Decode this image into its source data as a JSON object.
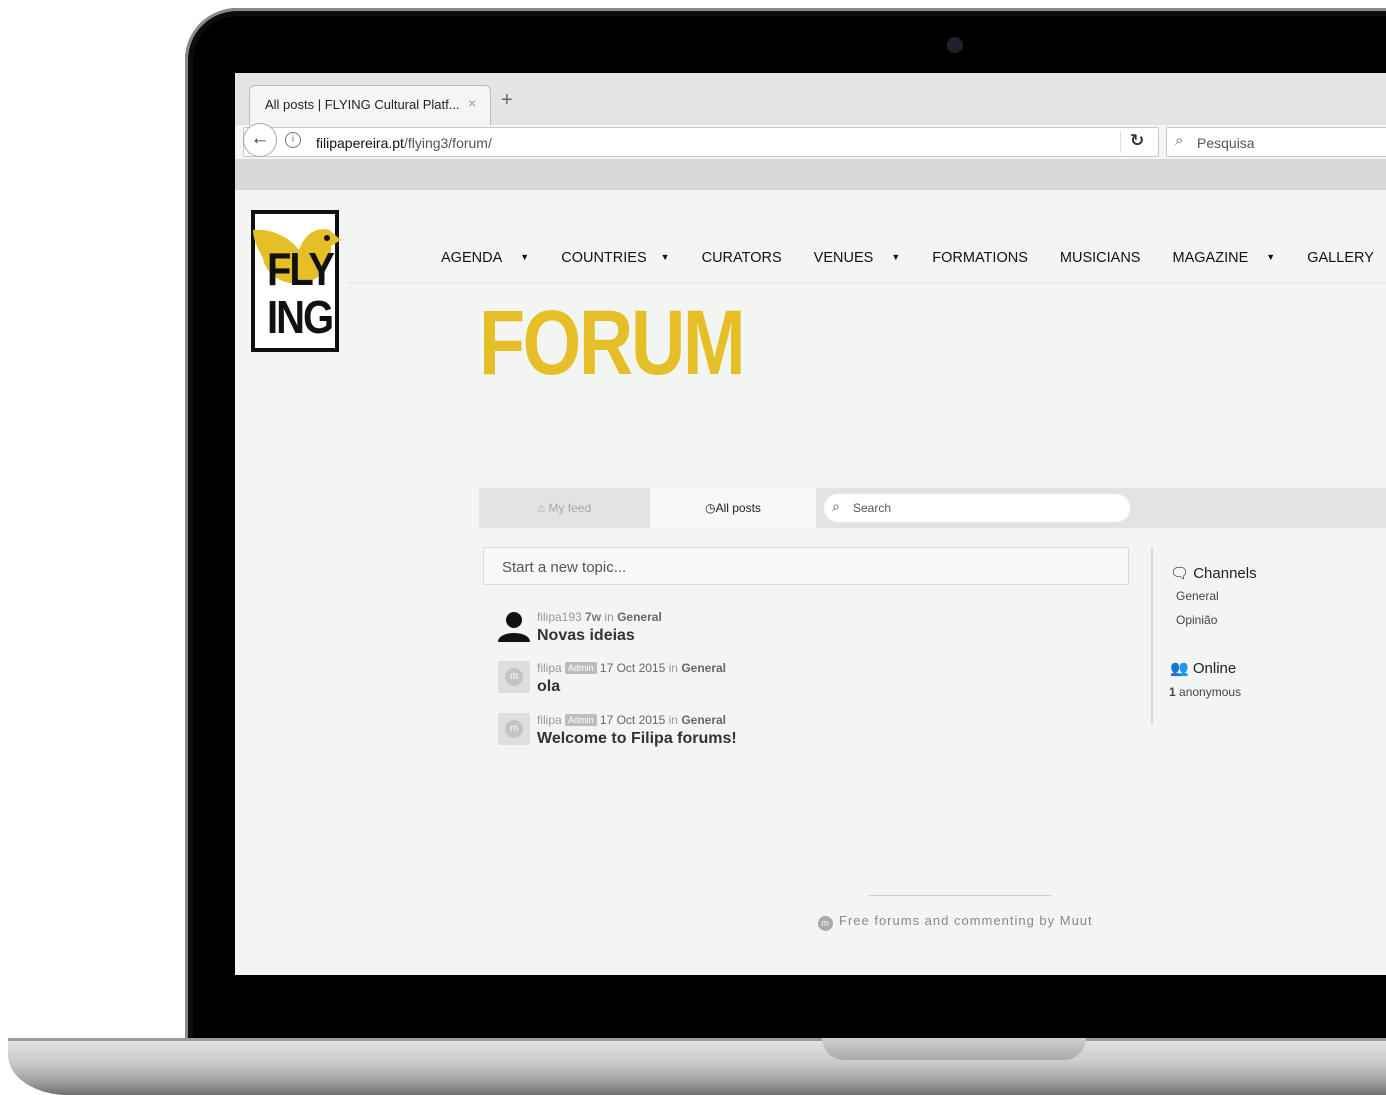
{
  "browser": {
    "tab_title": "All posts | FLYING Cultural Platf...",
    "tab_close": "×",
    "new_tab": "+",
    "url_host": "filipapereira.pt",
    "url_path": "/flying3/forum/",
    "search_placeholder": "Pesquisa"
  },
  "site": {
    "logo_line1": "FLY",
    "logo_line2": "ING",
    "brand_color": "#e4bf28",
    "nav": [
      {
        "label": "AGENDA",
        "dropdown": true
      },
      {
        "label": "COUNTRIES",
        "dropdown": true
      },
      {
        "label": "CURATORS",
        "dropdown": false
      },
      {
        "label": "VENUES",
        "dropdown": true
      },
      {
        "label": "FORMATIONS",
        "dropdown": false
      },
      {
        "label": "MUSICIANS",
        "dropdown": false
      },
      {
        "label": "MAGAZINE",
        "dropdown": true
      },
      {
        "label": "GALLERY",
        "dropdown": false
      }
    ],
    "page_title": "FORUM"
  },
  "forum": {
    "tabs": {
      "my_feed": "My feed",
      "all_posts": "All posts"
    },
    "search_placeholder": "Search",
    "new_topic_placeholder": "Start a new topic...",
    "posts": [
      {
        "author": "filipa193",
        "badge": "",
        "time": "7w",
        "in": "in",
        "channel": "General",
        "title": "Novas ideias",
        "avatar": "person-icon"
      },
      {
        "author": "filipa",
        "badge": "Admin",
        "time": "17 Oct 2015",
        "in": "in",
        "channel": "General",
        "title": "ola",
        "avatar": "muut-icon"
      },
      {
        "author": "filipa",
        "badge": "Admin",
        "time": "17 Oct 2015",
        "in": "in",
        "channel": "General",
        "title": "Welcome to Filipa forums!",
        "avatar": "muut-icon"
      }
    ],
    "sidebar": {
      "channels_title": "Channels",
      "channels": [
        "General",
        "Opinião"
      ],
      "online_title": "Online",
      "online_count": "1",
      "online_label": "anonymous"
    },
    "footer": "Free forums and commenting by Muut"
  }
}
